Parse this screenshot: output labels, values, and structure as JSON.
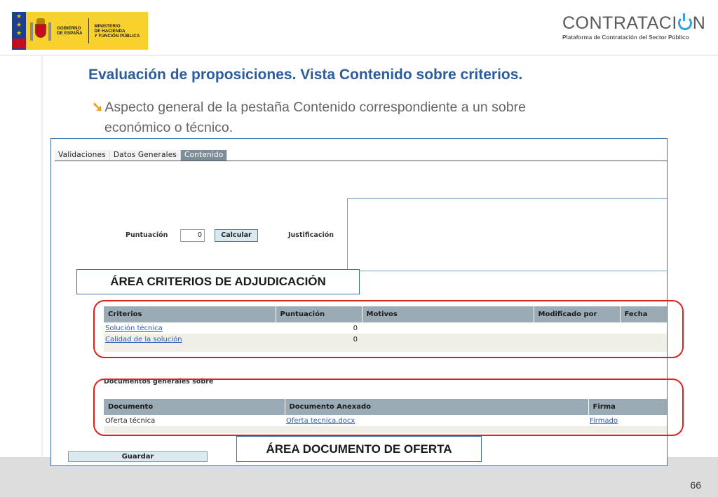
{
  "header": {
    "gov_lines_1": [
      "GOBIERNO",
      "DE ESPAÑA"
    ],
    "gov_lines_2": [
      "MINISTERIO",
      "DE HACIENDA",
      "Y FUNCIÓN PÚBLICA"
    ],
    "brand_name_a": "CONTRATACI",
    "brand_name_b": "N",
    "brand_subtitle": "Plataforma de Contratación del Sector Público"
  },
  "slide": {
    "title": "Evaluación de proposiciones. Vista Contenido sobre criterios.",
    "bullet_line_1": "Aspecto general de la pestaña Contenido correspondiente a un sobre",
    "bullet_line_2": "económico o técnico.",
    "page_number": "66"
  },
  "app": {
    "tabs": [
      "Validaciones",
      "Datos Generales",
      "Contenido"
    ],
    "active_tab": "Contenido",
    "score_label": "Puntuación",
    "score_value": "0",
    "calc_label": "Calcular",
    "justification_label": "Justificación",
    "criteria_table": {
      "headers": [
        "Criterios",
        "Puntuación",
        "Motivos",
        "Modificado por",
        "Fecha"
      ],
      "rows": [
        {
          "criterion": "Solución técnica",
          "score": "0"
        },
        {
          "criterion": "Calidad de la solución",
          "score": "0"
        }
      ]
    },
    "documents_title": "Documentos generales sobre",
    "documents_table": {
      "headers": [
        "Documento",
        "Documento Anexado",
        "Firma"
      ],
      "rows": [
        {
          "document": "Oferta técnica",
          "attachment": "Oferta tecnica.docx",
          "signature": "Firmado"
        }
      ]
    },
    "save_label": "Guardar"
  },
  "annotations": {
    "criteria_area": "ÁREA CRITERIOS DE ADJUDICACIÓN",
    "document_area": "ÁREA DOCUMENTO DE OFERTA",
    "highlight_color": "#e02020"
  }
}
